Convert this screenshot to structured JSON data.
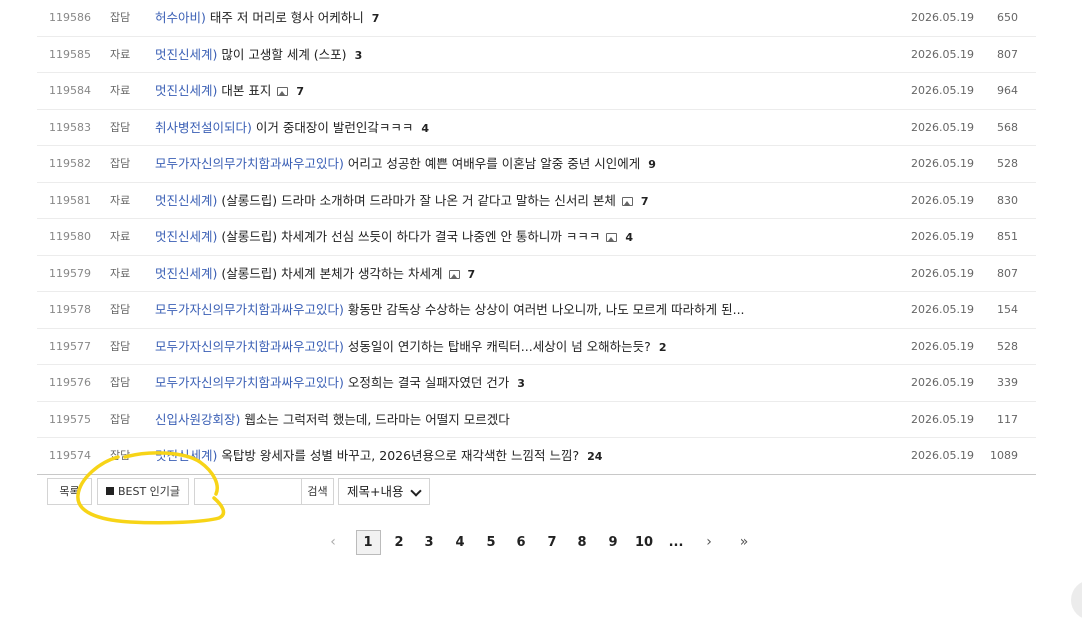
{
  "rows": [
    {
      "num": "119586",
      "cat": "잡담",
      "tag": "허수아비)",
      "subject": "태주 저 머리로 형사 어케하니",
      "has_image": false,
      "comments": "7",
      "date": "2026.05.19",
      "views": "650"
    },
    {
      "num": "119585",
      "cat": "자료",
      "tag": "멋진신세계)",
      "subject": "많이 고생할 세계 (스포)",
      "has_image": false,
      "comments": "3",
      "date": "2026.05.19",
      "views": "807"
    },
    {
      "num": "119584",
      "cat": "자료",
      "tag": "멋진신세계)",
      "subject": "대본 표지",
      "has_image": true,
      "comments": "7",
      "date": "2026.05.19",
      "views": "964"
    },
    {
      "num": "119583",
      "cat": "잡담",
      "tag": "취사병전설이되다)",
      "subject": "이거 중대장이 발런인갘ㅋㅋㅋ",
      "has_image": false,
      "comments": "4",
      "date": "2026.05.19",
      "views": "568"
    },
    {
      "num": "119582",
      "cat": "잡담",
      "tag": "모두가자신의무가치함과싸우고있다)",
      "subject": "어리고 성공한 예쁜 여배우를 이혼남 알중 중년 시인에게",
      "has_image": false,
      "comments": "9",
      "date": "2026.05.19",
      "views": "528"
    },
    {
      "num": "119581",
      "cat": "자료",
      "tag": "멋진신세계)",
      "subject": "(살롱드립) 드라마 소개하며 드라마가 잘 나온 거 같다고 말하는 신서리 본체",
      "has_image": true,
      "comments": "7",
      "date": "2026.05.19",
      "views": "830"
    },
    {
      "num": "119580",
      "cat": "자료",
      "tag": "멋진신세계)",
      "subject": "(살롱드립) 차세계가 선심 쓰듯이 하다가 결국 나중엔 안 통하니까 ㅋㅋㅋ",
      "has_image": true,
      "comments": "4",
      "date": "2026.05.19",
      "views": "851"
    },
    {
      "num": "119579",
      "cat": "자료",
      "tag": "멋진신세계)",
      "subject": "(살롱드립) 차세계 본체가 생각하는 차세계",
      "has_image": true,
      "comments": "7",
      "date": "2026.05.19",
      "views": "807"
    },
    {
      "num": "119578",
      "cat": "잡담",
      "tag": "모두가자신의무가치함과싸우고있다)",
      "subject": "황동만 감독상 수상하는 상상이 여러번 나오니까, 나도 모르게 따라하게 된...",
      "has_image": false,
      "comments": "",
      "date": "2026.05.19",
      "views": "154"
    },
    {
      "num": "119577",
      "cat": "잡담",
      "tag": "모두가자신의무가치함과싸우고있다)",
      "subject": "성동일이 연기하는 탑배우 캐릭터...세상이 넘 오해하는듯?",
      "has_image": false,
      "comments": "2",
      "date": "2026.05.19",
      "views": "528"
    },
    {
      "num": "119576",
      "cat": "잡담",
      "tag": "모두가자신의무가치함과싸우고있다)",
      "subject": "오정희는 결국 실패자였던 건가",
      "has_image": false,
      "comments": "3",
      "date": "2026.05.19",
      "views": "339"
    },
    {
      "num": "119575",
      "cat": "잡담",
      "tag": "신입사원강회장)",
      "subject": "웹소는 그럭저럭 했는데, 드라마는 어떨지 모르겠다",
      "has_image": false,
      "comments": "",
      "date": "2026.05.19",
      "views": "117"
    },
    {
      "num": "119574",
      "cat": "잡담",
      "tag": "멋진신세계)",
      "subject": "옥탑방 왕세자를 성별 바꾸고, 2026년용으로 재각색한 느낌적 느낌?",
      "has_image": false,
      "comments": "24",
      "date": "2026.05.19",
      "views": "1089"
    }
  ],
  "toolbar": {
    "list_label": "목록",
    "best_label": "BEST 인기글",
    "search_value": "",
    "search_button": "검색",
    "search_scope": "제목+내용"
  },
  "pagination": {
    "prev": "‹",
    "pages": [
      "1",
      "2",
      "3",
      "4",
      "5",
      "6",
      "7",
      "8",
      "9",
      "10",
      "..."
    ],
    "current": "1",
    "next": "›",
    "last": "»"
  },
  "colors": {
    "tag": "#3a5fb5",
    "annotation_highlight": "#f7d417"
  }
}
